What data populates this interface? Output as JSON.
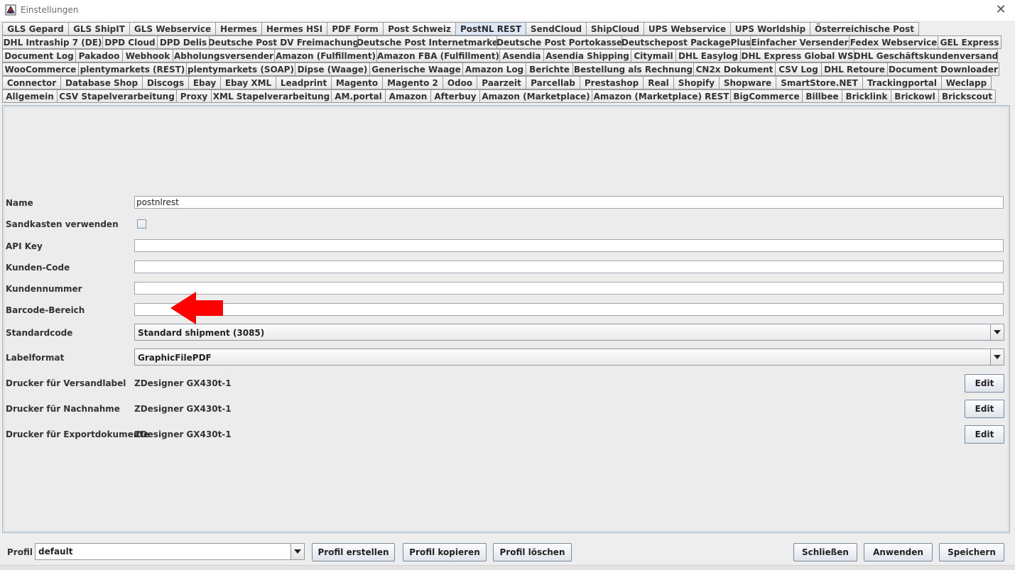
{
  "window": {
    "title": "Einstellungen",
    "close_glyph": "✕"
  },
  "tab_rows": [
    [
      "GLS Gepard",
      "GLS ShipIT",
      "GLS Webservice",
      "Hermes",
      "Hermes HSI",
      "PDF Form",
      "Post Schweiz",
      "PostNL REST",
      "SendCloud",
      "ShipCloud",
      "UPS Webservice",
      "UPS Worldship",
      "Österreichische Post"
    ],
    [
      "DHL Intraship 7 (DE)",
      "DPD Cloud",
      "DPD Delis",
      "Deutsche Post DV Freimachung",
      "Deutsche Post Internetmarke",
      "Deutsche Post Portokasse",
      "Deutschepost PackagePlus",
      "Einfacher Versender",
      "Fedex Webservice",
      "GEL Express"
    ],
    [
      "Document Log",
      "Pakadoo",
      "Webhook",
      "Abholungsversender",
      "Amazon (Fulfillment)",
      "Amazon FBA (Fulfillment)",
      "Asendia",
      "Asendia Shipping",
      "Citymail",
      "DHL Easylog",
      "DHL Express Global WS",
      "DHL Geschäftskundenversand"
    ],
    [
      "WooCommerce",
      "plentymarkets (REST)",
      "plentymarkets (SOAP)",
      "Dipse (Waage)",
      "Generische Waage",
      "Amazon Log",
      "Berichte",
      "Bestellung als Rechnung",
      "CN2x Dokument",
      "CSV Log",
      "DHL Retoure",
      "Document Downloader"
    ],
    [
      "Connector",
      "Database Shop",
      "Discogs",
      "Ebay",
      "Ebay XML",
      "Leadprint",
      "Magento",
      "Magento 2",
      "Odoo",
      "Paarzeit",
      "Parcellab",
      "Prestashop",
      "Real",
      "Shopify",
      "Shopware",
      "SmartStore.NET",
      "Trackingportal",
      "Weclapp"
    ],
    [
      "Allgemein",
      "CSV Stapelverarbeitung",
      "Proxy",
      "XML Stapelverarbeitung",
      "AM.portal",
      "Amazon",
      "Afterbuy",
      "Amazon (Marketplace)",
      "Amazon (Marketplace) REST",
      "BigCommerce",
      "Billbee",
      "Bricklink",
      "Brickowl",
      "Brickscout"
    ]
  ],
  "active_tab": "PostNL REST",
  "form": {
    "name_label": "Name",
    "name_value": "postnlrest",
    "sandbox_label": "Sandkasten verwenden",
    "apikey_label": "API Key",
    "apikey_value": "",
    "customer_code_label": "Kunden-Code",
    "customer_code_value": "",
    "customer_number_label": "Kundennummer",
    "customer_number_value": "",
    "barcode_label": "Barcode-Bereich",
    "barcode_value": "",
    "standardcode_label": "Standardcode",
    "standardcode_value": "Standard shipment (3085)",
    "labelformat_label": "Labelformat",
    "labelformat_value": "GraphicFilePDF",
    "printer_label_label": "Drucker für Versandlabel",
    "printer_label_value": "ZDesigner GX430t-1",
    "printer_cod_label": "Drucker für Nachnahme",
    "printer_cod_value": "ZDesigner GX430t-1",
    "printer_export_label": "Drucker für Exportdokumente",
    "printer_export_value": "ZDesigner GX430t-1",
    "edit_label": "Edit"
  },
  "annotation": {
    "arrow_color": "#ff0000"
  },
  "footer": {
    "profile_label": "Profil",
    "profile_value": "default",
    "create_label": "Profil erstellen",
    "copy_label": "Profil kopieren",
    "delete_label": "Profil löschen",
    "close_label": "Schließen",
    "apply_label": "Anwenden",
    "save_label": "Speichern"
  }
}
